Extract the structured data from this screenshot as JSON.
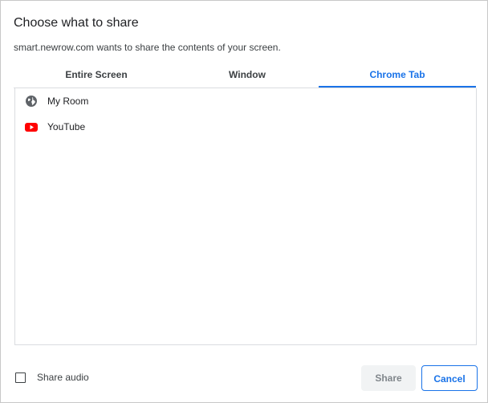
{
  "dialog": {
    "title": "Choose what to share",
    "subtitle": "smart.newrow.com wants to share the contents of your screen."
  },
  "tabs": [
    {
      "label": "Entire Screen",
      "selected": false
    },
    {
      "label": "Window",
      "selected": false
    },
    {
      "label": "Chrome Tab",
      "selected": true
    }
  ],
  "items": [
    {
      "label": "My Room",
      "icon": "globe-icon"
    },
    {
      "label": "YouTube",
      "icon": "youtube-icon"
    }
  ],
  "footer": {
    "share_audio_label": "Share audio",
    "share_audio_checked": false,
    "share_label": "Share",
    "cancel_label": "Cancel"
  },
  "colors": {
    "accent": "#1a73e8",
    "youtube_red": "#ff0000"
  }
}
